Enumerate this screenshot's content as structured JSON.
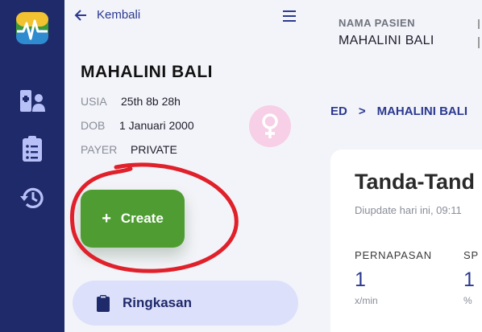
{
  "rail": {
    "logo": "heartbeat-logo",
    "icons": [
      "patient-list-icon",
      "clipboard-icon",
      "history-icon"
    ]
  },
  "panel": {
    "back_label": "Kembali",
    "patient_name": "MAHALINI BALI",
    "usia_label": "USIA",
    "usia_value": "25th 8b 28h",
    "dob_label": "DOB",
    "dob_value": "1 Januari 2000",
    "payer_label": "PAYER",
    "payer_value": "PRIVATE",
    "gender_icon": "female-icon",
    "create_label": "Create",
    "ringkasan_label": "Ringkasan"
  },
  "header": {
    "nama_label": "NAMA PASIEN",
    "nama_value": "MAHALINI BALI"
  },
  "breadcrumb": {
    "first": "ED",
    "separator": ">",
    "second": "MAHALINI BALI"
  },
  "vitals": {
    "title": "Tanda-Tand",
    "updated": "Diupdate hari ini, 09:11",
    "items": [
      {
        "label": "PERNAPASAN",
        "value": "1",
        "unit": "x/min"
      },
      {
        "label": "SP",
        "value": "1",
        "unit": "%"
      }
    ]
  },
  "colors": {
    "rail": "#1f2a6b",
    "accent": "#2b3990",
    "create": "#4f9d32",
    "annotation": "#e0202a"
  }
}
